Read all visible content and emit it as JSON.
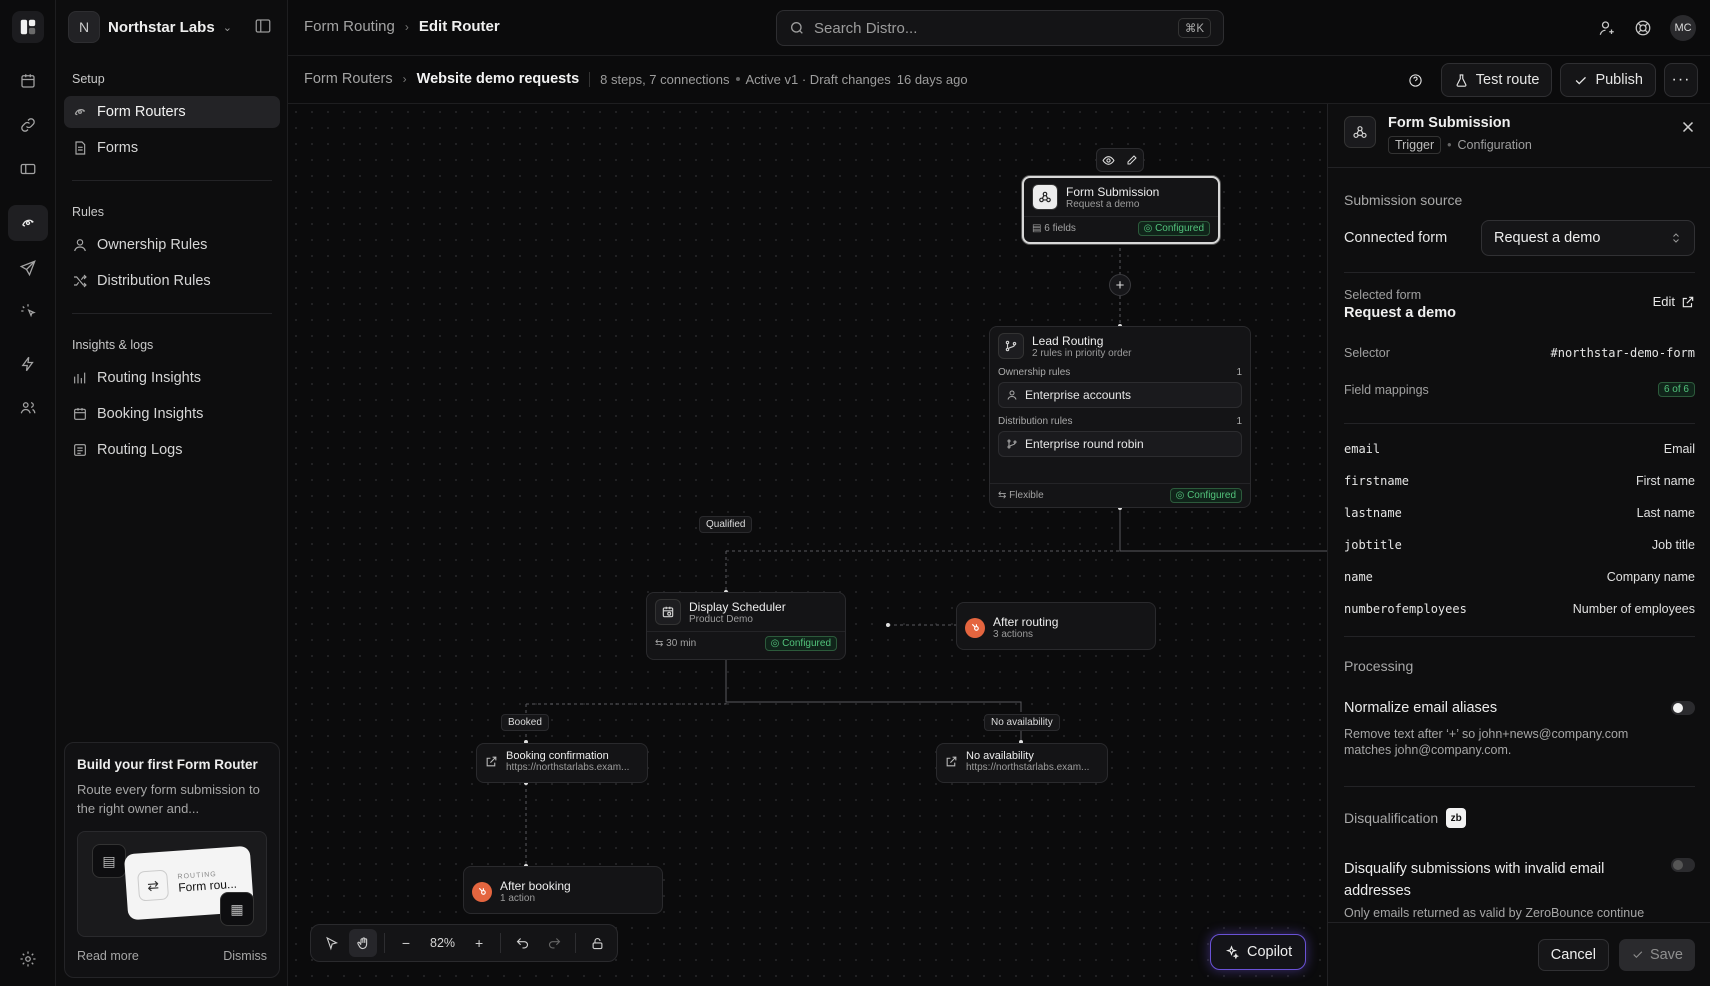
{
  "workspace": {
    "initial": "N",
    "name": "Northstar Labs"
  },
  "topbar": {
    "breadcrumb": {
      "parent": "Form Routing",
      "current": "Edit Router"
    },
    "search_placeholder": "Search Distro...",
    "search_shortcut": "⌘K",
    "avatar": "MC"
  },
  "sidebar": {
    "sections": [
      {
        "title": "Setup",
        "items": [
          {
            "label": "Form Routers",
            "icon": "router-icon",
            "active": true
          },
          {
            "label": "Forms",
            "icon": "document-icon"
          }
        ]
      },
      {
        "title": "Rules",
        "items": [
          {
            "label": "Ownership Rules",
            "icon": "user-icon"
          },
          {
            "label": "Distribution Rules",
            "icon": "shuffle-icon"
          }
        ]
      },
      {
        "title": "Insights & logs",
        "items": [
          {
            "label": "Routing Insights",
            "icon": "chart-icon"
          },
          {
            "label": "Booking Insights",
            "icon": "calendar-icon"
          },
          {
            "label": "Routing Logs",
            "icon": "list-icon"
          }
        ]
      }
    ],
    "promo": {
      "title": "Build your first Form Router",
      "desc": "Route every form submission to the right owner and...",
      "img_kicker": "ROUTING",
      "img_title": "Form rou...",
      "read_more": "Read more",
      "dismiss": "Dismiss"
    }
  },
  "subbar": {
    "parent": "Form Routers",
    "current": "Website demo requests",
    "meta_steps": "8 steps, 7 connections",
    "meta_status": "Active v1 · Draft changes",
    "meta_time": "16 days ago",
    "test_label": "Test route",
    "publish_label": "Publish"
  },
  "canvas": {
    "form_node": {
      "title": "Form Submission",
      "sub": "Request a demo",
      "fields": "6 fields",
      "status": "Configured"
    },
    "routing_node": {
      "title": "Lead Routing",
      "sub": "2 rules in priority order",
      "ownership_label": "Ownership rules",
      "ownership_count": "1",
      "ownership_rule": "Enterprise accounts",
      "distribution_label": "Distribution rules",
      "distribution_count": "1",
      "distribution_rule": "Enterprise round robin",
      "mode": "Flexible",
      "status": "Configured"
    },
    "edge_qualified": "Qualified",
    "scheduler_node": {
      "title": "Display Scheduler",
      "sub": "Product Demo",
      "duration": "30 min",
      "status": "Configured"
    },
    "after_routing": {
      "title": "After routing",
      "sub": "3 actions"
    },
    "edge_booked": "Booked",
    "edge_noavail": "No availability",
    "booking_conf": {
      "title": "Booking confirmation",
      "url": "https://northstarlabs.exam..."
    },
    "no_avail": {
      "title": "No availability",
      "url": "https://northstarlabs.exam..."
    },
    "after_booking": {
      "title": "After booking",
      "sub": "1 action"
    },
    "zoom": "82%",
    "copilot": "Copilot"
  },
  "panel": {
    "title": "Form Submission",
    "chip": "Trigger",
    "tab": "Configuration",
    "section_source": "Submission source",
    "connected_form_label": "Connected form",
    "connected_form_value": "Request a demo",
    "selected_form_label": "Selected form",
    "selected_form_value": "Request a demo",
    "edit_label": "Edit",
    "selector_label": "Selector",
    "selector_value": "#northstar-demo-form",
    "field_mappings_label": "Field mappings",
    "field_mappings_badge": "6 of 6",
    "mappings": [
      {
        "key": "email",
        "value": "Email"
      },
      {
        "key": "firstname",
        "value": "First name"
      },
      {
        "key": "lastname",
        "value": "Last name"
      },
      {
        "key": "jobtitle",
        "value": "Job title"
      },
      {
        "key": "name",
        "value": "Company name"
      },
      {
        "key": "numberofemployees",
        "value": "Number of employees"
      }
    ],
    "section_processing": "Processing",
    "normalize_title": "Normalize email aliases",
    "normalize_desc": "Remove text after ‘+’ so john+news@company.com matches john@company.com.",
    "section_disq": "Disqualification",
    "disq_badge": "zb",
    "disq_title": "Disqualify submissions with invalid email addresses",
    "disq_desc": "Only emails returned as valid by ZeroBounce continue",
    "cancel_label": "Cancel",
    "save_label": "Save"
  }
}
